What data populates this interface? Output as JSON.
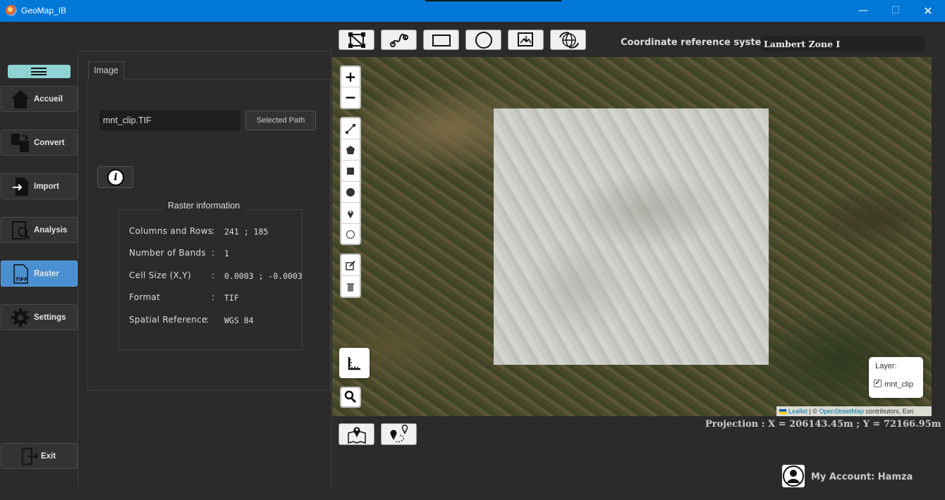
{
  "window": {
    "title": "GeoMap_IB",
    "minimize": "—",
    "maximize": "☐",
    "close": "✕"
  },
  "sidebar": {
    "items": [
      {
        "label": "Accueil",
        "icon": "home-icon"
      },
      {
        "label": "Convert",
        "icon": "convert-icon"
      },
      {
        "label": "Import",
        "icon": "import-icon"
      },
      {
        "label": "Analysis",
        "icon": "analysis-icon"
      },
      {
        "label": "Raster",
        "icon": "tiff-icon",
        "active": true
      },
      {
        "label": "Settings",
        "icon": "gear-icon"
      }
    ],
    "exit_label": "Exit"
  },
  "panel": {
    "tab_label": "Image",
    "file_value": "mnt_clip.TIF",
    "path_button": "Selected Path",
    "info_icon": "i",
    "raster_title": "Raster information",
    "rows": [
      {
        "label": "Columns and Rows",
        "sep": ":",
        "value": "241 ; 185"
      },
      {
        "label": "Number of Bands",
        "sep": ":",
        "value": "1"
      },
      {
        "label": "Cell Size (X,Y)",
        "sep": ":",
        "value": "0.0003 ; -0.0003"
      },
      {
        "label": "Format",
        "sep": ":",
        "value": "TIF"
      },
      {
        "label": "Spatial Reference",
        "sep": ":",
        "value": "WGS 84"
      }
    ]
  },
  "toolbar": {
    "tools": [
      "polyline-draw-icon",
      "route-icon",
      "rectangle-icon",
      "circle-icon",
      "export-image-icon",
      "globe-refresh-icon"
    ],
    "crs_label": "Coordinate reference system :",
    "crs_value": "Lambert Zone I"
  },
  "map": {
    "zoom_in": "+",
    "zoom_out": "−",
    "layer_title": "Layer:",
    "layer_name": "mnt_clip",
    "layer_checked": true,
    "attribution_leaflet": "Leaflet",
    "attribution_sep": " | © ",
    "attribution_osm": "OpenStreetMap",
    "attribution_rest": " contributors, Esri"
  },
  "projection": "Projection : X = 206143.45m ; Y = 72166.95m",
  "account": "My Account: Hamza",
  "colors": {
    "titlebar": "#0078d7",
    "active_nav": "#4a8fd0",
    "menu_toggle": "#8fd3d3",
    "background": "#2b2b2b"
  }
}
